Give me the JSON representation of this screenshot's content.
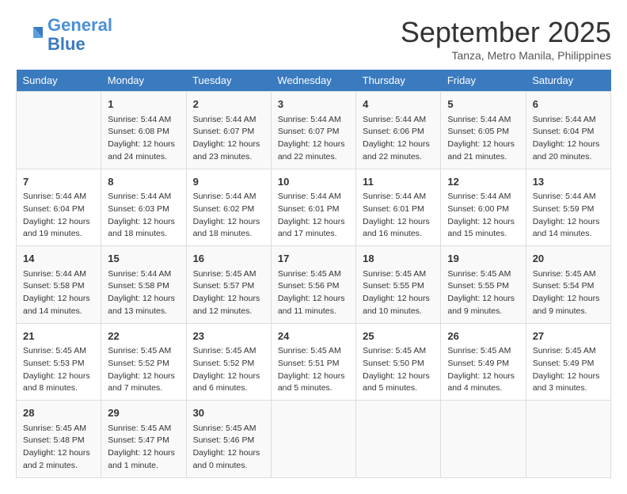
{
  "logo": {
    "line1": "General",
    "line2": "Blue"
  },
  "header": {
    "month": "September 2025",
    "location": "Tanza, Metro Manila, Philippines"
  },
  "weekdays": [
    "Sunday",
    "Monday",
    "Tuesday",
    "Wednesday",
    "Thursday",
    "Friday",
    "Saturday"
  ],
  "weeks": [
    [
      {
        "day": "",
        "sunrise": "",
        "sunset": "",
        "daylight": ""
      },
      {
        "day": "1",
        "sunrise": "Sunrise: 5:44 AM",
        "sunset": "Sunset: 6:08 PM",
        "daylight": "Daylight: 12 hours and 24 minutes."
      },
      {
        "day": "2",
        "sunrise": "Sunrise: 5:44 AM",
        "sunset": "Sunset: 6:07 PM",
        "daylight": "Daylight: 12 hours and 23 minutes."
      },
      {
        "day": "3",
        "sunrise": "Sunrise: 5:44 AM",
        "sunset": "Sunset: 6:07 PM",
        "daylight": "Daylight: 12 hours and 22 minutes."
      },
      {
        "day": "4",
        "sunrise": "Sunrise: 5:44 AM",
        "sunset": "Sunset: 6:06 PM",
        "daylight": "Daylight: 12 hours and 22 minutes."
      },
      {
        "day": "5",
        "sunrise": "Sunrise: 5:44 AM",
        "sunset": "Sunset: 6:05 PM",
        "daylight": "Daylight: 12 hours and 21 minutes."
      },
      {
        "day": "6",
        "sunrise": "Sunrise: 5:44 AM",
        "sunset": "Sunset: 6:04 PM",
        "daylight": "Daylight: 12 hours and 20 minutes."
      }
    ],
    [
      {
        "day": "7",
        "sunrise": "Sunrise: 5:44 AM",
        "sunset": "Sunset: 6:04 PM",
        "daylight": "Daylight: 12 hours and 19 minutes."
      },
      {
        "day": "8",
        "sunrise": "Sunrise: 5:44 AM",
        "sunset": "Sunset: 6:03 PM",
        "daylight": "Daylight: 12 hours and 18 minutes."
      },
      {
        "day": "9",
        "sunrise": "Sunrise: 5:44 AM",
        "sunset": "Sunset: 6:02 PM",
        "daylight": "Daylight: 12 hours and 18 minutes."
      },
      {
        "day": "10",
        "sunrise": "Sunrise: 5:44 AM",
        "sunset": "Sunset: 6:01 PM",
        "daylight": "Daylight: 12 hours and 17 minutes."
      },
      {
        "day": "11",
        "sunrise": "Sunrise: 5:44 AM",
        "sunset": "Sunset: 6:01 PM",
        "daylight": "Daylight: 12 hours and 16 minutes."
      },
      {
        "day": "12",
        "sunrise": "Sunrise: 5:44 AM",
        "sunset": "Sunset: 6:00 PM",
        "daylight": "Daylight: 12 hours and 15 minutes."
      },
      {
        "day": "13",
        "sunrise": "Sunrise: 5:44 AM",
        "sunset": "Sunset: 5:59 PM",
        "daylight": "Daylight: 12 hours and 14 minutes."
      }
    ],
    [
      {
        "day": "14",
        "sunrise": "Sunrise: 5:44 AM",
        "sunset": "Sunset: 5:58 PM",
        "daylight": "Daylight: 12 hours and 14 minutes."
      },
      {
        "day": "15",
        "sunrise": "Sunrise: 5:44 AM",
        "sunset": "Sunset: 5:58 PM",
        "daylight": "Daylight: 12 hours and 13 minutes."
      },
      {
        "day": "16",
        "sunrise": "Sunrise: 5:45 AM",
        "sunset": "Sunset: 5:57 PM",
        "daylight": "Daylight: 12 hours and 12 minutes."
      },
      {
        "day": "17",
        "sunrise": "Sunrise: 5:45 AM",
        "sunset": "Sunset: 5:56 PM",
        "daylight": "Daylight: 12 hours and 11 minutes."
      },
      {
        "day": "18",
        "sunrise": "Sunrise: 5:45 AM",
        "sunset": "Sunset: 5:55 PM",
        "daylight": "Daylight: 12 hours and 10 minutes."
      },
      {
        "day": "19",
        "sunrise": "Sunrise: 5:45 AM",
        "sunset": "Sunset: 5:55 PM",
        "daylight": "Daylight: 12 hours and 9 minutes."
      },
      {
        "day": "20",
        "sunrise": "Sunrise: 5:45 AM",
        "sunset": "Sunset: 5:54 PM",
        "daylight": "Daylight: 12 hours and 9 minutes."
      }
    ],
    [
      {
        "day": "21",
        "sunrise": "Sunrise: 5:45 AM",
        "sunset": "Sunset: 5:53 PM",
        "daylight": "Daylight: 12 hours and 8 minutes."
      },
      {
        "day": "22",
        "sunrise": "Sunrise: 5:45 AM",
        "sunset": "Sunset: 5:52 PM",
        "daylight": "Daylight: 12 hours and 7 minutes."
      },
      {
        "day": "23",
        "sunrise": "Sunrise: 5:45 AM",
        "sunset": "Sunset: 5:52 PM",
        "daylight": "Daylight: 12 hours and 6 minutes."
      },
      {
        "day": "24",
        "sunrise": "Sunrise: 5:45 AM",
        "sunset": "Sunset: 5:51 PM",
        "daylight": "Daylight: 12 hours and 5 minutes."
      },
      {
        "day": "25",
        "sunrise": "Sunrise: 5:45 AM",
        "sunset": "Sunset: 5:50 PM",
        "daylight": "Daylight: 12 hours and 5 minutes."
      },
      {
        "day": "26",
        "sunrise": "Sunrise: 5:45 AM",
        "sunset": "Sunset: 5:49 PM",
        "daylight": "Daylight: 12 hours and 4 minutes."
      },
      {
        "day": "27",
        "sunrise": "Sunrise: 5:45 AM",
        "sunset": "Sunset: 5:49 PM",
        "daylight": "Daylight: 12 hours and 3 minutes."
      }
    ],
    [
      {
        "day": "28",
        "sunrise": "Sunrise: 5:45 AM",
        "sunset": "Sunset: 5:48 PM",
        "daylight": "Daylight: 12 hours and 2 minutes."
      },
      {
        "day": "29",
        "sunrise": "Sunrise: 5:45 AM",
        "sunset": "Sunset: 5:47 PM",
        "daylight": "Daylight: 12 hours and 1 minute."
      },
      {
        "day": "30",
        "sunrise": "Sunrise: 5:45 AM",
        "sunset": "Sunset: 5:46 PM",
        "daylight": "Daylight: 12 hours and 0 minutes."
      },
      {
        "day": "",
        "sunrise": "",
        "sunset": "",
        "daylight": ""
      },
      {
        "day": "",
        "sunrise": "",
        "sunset": "",
        "daylight": ""
      },
      {
        "day": "",
        "sunrise": "",
        "sunset": "",
        "daylight": ""
      },
      {
        "day": "",
        "sunrise": "",
        "sunset": "",
        "daylight": ""
      }
    ]
  ]
}
